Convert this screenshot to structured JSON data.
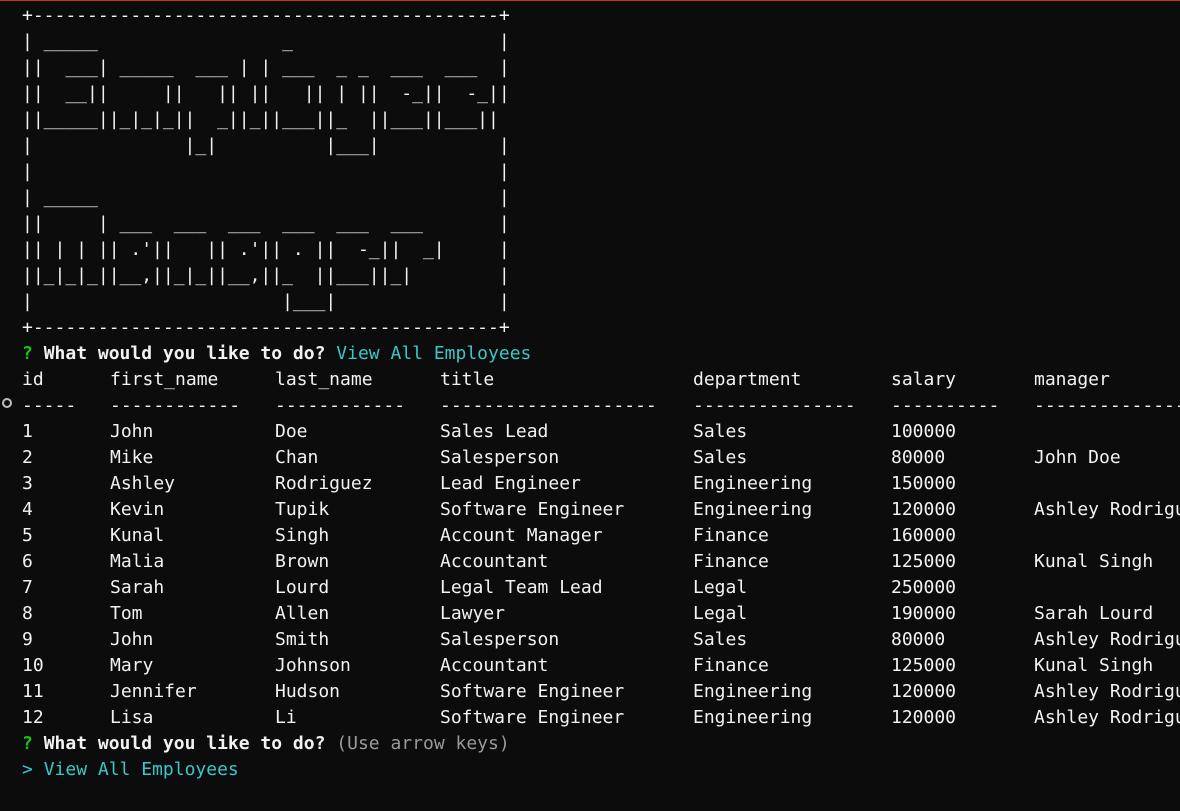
{
  "banner": "+-------------------------------------------+\n| _____                 _                   |\n||  ___| _____  ___ | | ___  _ _  ___  ___  |\n||  __||     ||   || ||   || | ||  -_||  -_||\n||_____||_|_|_||  _||_||___||_  ||___||___||\n|              |_|          |___|           |\n|                                           |\n| _____                                     |\n||     | ___  ___  ___  ___  ___  ___       |\n|| | | || .'||   || .'|| . ||  -_||  _|     |\n||_|_|_||__,||_|_||__,||_  ||___||_|        |\n|                       |___|               |\n+-------------------------------------------+",
  "prompt1": {
    "mark": "?",
    "question": "What would you like to do?",
    "answer": "View All Employees"
  },
  "table": {
    "headers": [
      "id",
      "first_name",
      "last_name",
      "title",
      "department",
      "salary",
      "manager"
    ],
    "separators": [
      "-----",
      "------------",
      "------------",
      "--------------------",
      "---------------",
      "----------",
      "----------------"
    ],
    "rows": [
      [
        "1",
        "John",
        "Doe",
        "Sales Lead",
        "Sales",
        "100000",
        ""
      ],
      [
        "2",
        "Mike",
        "Chan",
        "Salesperson",
        "Sales",
        "80000",
        "John Doe"
      ],
      [
        "3",
        "Ashley",
        "Rodriguez",
        "Lead Engineer",
        "Engineering",
        "150000",
        ""
      ],
      [
        "4",
        "Kevin",
        "Tupik",
        "Software Engineer",
        "Engineering",
        "120000",
        "Ashley Rodriguez"
      ],
      [
        "5",
        "Kunal",
        "Singh",
        "Account Manager",
        "Finance",
        "160000",
        ""
      ],
      [
        "6",
        "Malia",
        "Brown",
        "Accountant",
        "Finance",
        "125000",
        "Kunal Singh"
      ],
      [
        "7",
        "Sarah",
        "Lourd",
        "Legal Team Lead",
        "Legal",
        "250000",
        ""
      ],
      [
        "8",
        "Tom",
        "Allen",
        "Lawyer",
        "Legal",
        "190000",
        "Sarah Lourd"
      ],
      [
        "9",
        "John",
        "Smith",
        "Salesperson",
        "Sales",
        "80000",
        "Ashley Rodriguez"
      ],
      [
        "10",
        "Mary",
        "Johnson",
        "Accountant",
        "Finance",
        "125000",
        "Kunal Singh"
      ],
      [
        "11",
        "Jennifer",
        "Hudson",
        "Software Engineer",
        "Engineering",
        "120000",
        "Ashley Rodriguez"
      ],
      [
        "12",
        "Lisa",
        "Li",
        "Software Engineer",
        "Engineering",
        "120000",
        "Ashley Rodriguez"
      ]
    ]
  },
  "prompt2": {
    "mark": "?",
    "question": "What would you like to do?",
    "hint": "(Use arrow keys)"
  },
  "menu": {
    "pointer": ">",
    "selected": "View All Employees"
  },
  "colors": {
    "background": "#0c0c0c",
    "text": "#f2f2f2",
    "prompt_mark": "#16c60c",
    "answer": "#3ac7c9",
    "hint": "#9a9a9a"
  }
}
